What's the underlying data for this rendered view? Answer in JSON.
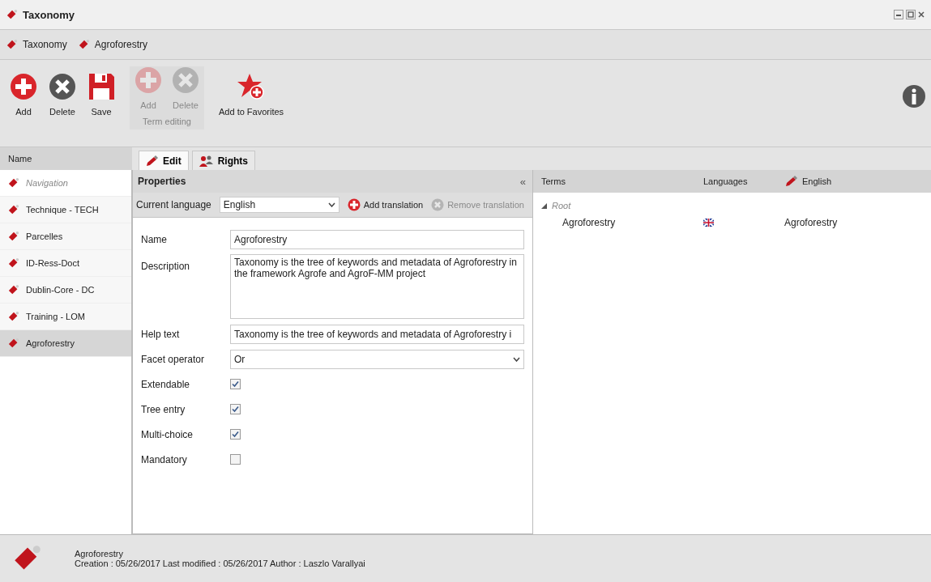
{
  "window": {
    "title": "Taxonomy"
  },
  "breadcrumb": [
    {
      "label": "Taxonomy"
    },
    {
      "label": "Agroforestry"
    }
  ],
  "toolbar": [
    {
      "kind": "add",
      "label": "Add",
      "disabled": false
    },
    {
      "kind": "delete",
      "label": "Delete",
      "disabled": false
    },
    {
      "kind": "save",
      "label": "Save",
      "disabled": false
    },
    {
      "kind": "group",
      "label": "Term editing",
      "buttons": [
        {
          "kind": "add",
          "label": "Add",
          "disabled": true
        },
        {
          "kind": "delete",
          "label": "Delete",
          "disabled": true
        }
      ]
    },
    {
      "kind": "favorite",
      "label": "Add to Favorites",
      "disabled": false
    }
  ],
  "sidebar": {
    "header": "Name",
    "items": [
      {
        "label": "Navigation",
        "kind": "navigation",
        "selected": false
      },
      {
        "label": "Technique - TECH",
        "kind": "taxonomy",
        "selected": false
      },
      {
        "label": "Parcelles",
        "kind": "taxonomy",
        "selected": false
      },
      {
        "label": "ID-Ress-Doct",
        "kind": "taxonomy",
        "selected": false
      },
      {
        "label": "Dublin-Core - DC",
        "kind": "taxonomy",
        "selected": false
      },
      {
        "label": "Training - LOM",
        "kind": "taxonomy",
        "selected": false
      },
      {
        "label": "Agroforestry",
        "kind": "taxonomy",
        "selected": true
      }
    ]
  },
  "tabs": [
    {
      "label": "Edit",
      "selected": true
    },
    {
      "label": "Rights",
      "selected": false
    }
  ],
  "properties": {
    "title": "Properties",
    "collapse": "«",
    "language_bar": {
      "label": "Current language",
      "value": "English",
      "add": {
        "label": "Add translation",
        "disabled": false
      },
      "remove": {
        "label": "Remove translation",
        "disabled": true
      }
    },
    "fields": [
      {
        "kind": "text",
        "label": "Name",
        "value": "Agroforestry"
      },
      {
        "kind": "textarea",
        "label": "Description",
        "value": "Taxonomy is the tree of keywords and metadata of Agroforestry in the framework Agrofe and AgroF-MM project"
      },
      {
        "kind": "text",
        "label": "Help text",
        "value": "Taxonomy is the tree of keywords and metadata of Agroforestry i"
      },
      {
        "kind": "select",
        "label": "Facet operator",
        "value": "Or"
      },
      {
        "kind": "checkbox",
        "label": "Extendable",
        "checked": true
      },
      {
        "kind": "checkbox",
        "label": "Tree entry",
        "checked": true
      },
      {
        "kind": "checkbox",
        "label": "Multi-choice",
        "checked": true
      },
      {
        "kind": "checkbox",
        "label": "Mandatory",
        "checked": false
      }
    ]
  },
  "terms": {
    "columns": [
      "Terms",
      "Languages",
      "English"
    ],
    "tree": [
      {
        "label": "Root",
        "expanded": true,
        "children": [
          {
            "term": "Agroforestry",
            "english": "Agroforestry"
          }
        ]
      }
    ]
  },
  "status_bar": {
    "title": "Agroforestry",
    "details": "Creation : 05/26/2017 Last modified : 05/26/2017 Author : Laszlo Varallyai"
  }
}
